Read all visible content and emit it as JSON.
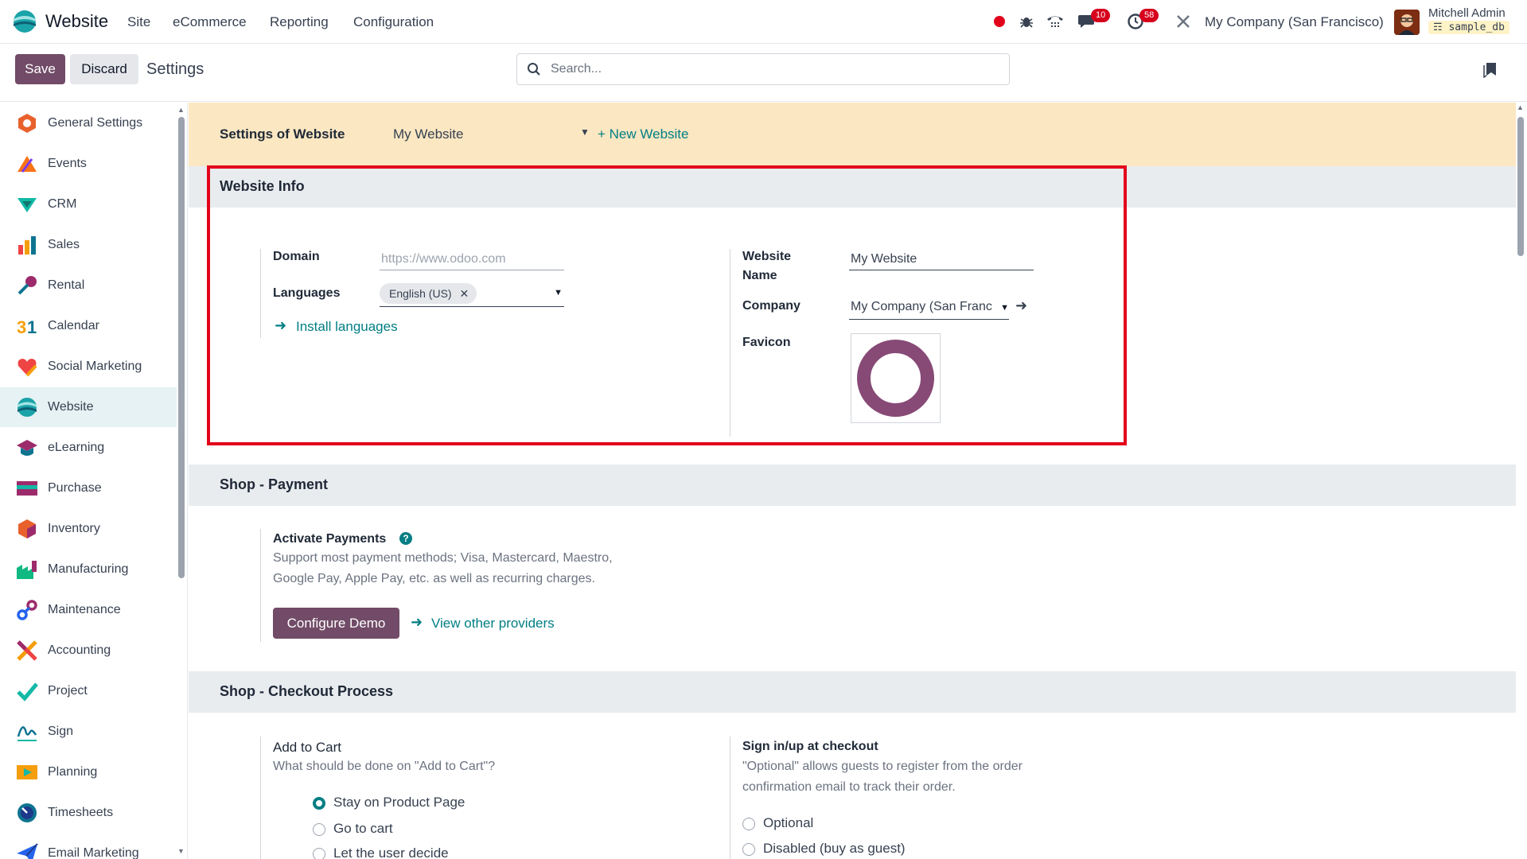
{
  "navbar": {
    "app_name": "Website",
    "menu": [
      "Site",
      "eCommerce",
      "Reporting",
      "Configuration"
    ],
    "chat_badge": "10",
    "activity_badge": "58",
    "company": "My Company (San Francisco)",
    "user_name": "Mitchell Admin",
    "db_name": "sample_db"
  },
  "control": {
    "save_label": "Save",
    "discard_label": "Discard",
    "breadcrumb": "Settings",
    "search_placeholder": "Search..."
  },
  "sidebar": {
    "items": [
      {
        "label": "General Settings",
        "icon": "general-settings-icon",
        "color": "#e8612c"
      },
      {
        "label": "Events",
        "icon": "events-icon",
        "color": "#f97316"
      },
      {
        "label": "CRM",
        "icon": "crm-icon",
        "color": "#10b9a6"
      },
      {
        "label": "Sales",
        "icon": "sales-icon",
        "color": "#f59e0b"
      },
      {
        "label": "Rental",
        "icon": "rental-icon",
        "color": "#0e7490"
      },
      {
        "label": "Calendar",
        "icon": "calendar-icon",
        "color": "#f59e0b"
      },
      {
        "label": "Social Marketing",
        "icon": "social-marketing-icon",
        "color": "#ef4444"
      },
      {
        "label": "Website",
        "icon": "website-icon",
        "color": "#1aa3a8"
      },
      {
        "label": "eLearning",
        "icon": "elearning-icon",
        "color": "#0e7490"
      },
      {
        "label": "Purchase",
        "icon": "purchase-icon",
        "color": "#9d2b6b"
      },
      {
        "label": "Inventory",
        "icon": "inventory-icon",
        "color": "#e8612c"
      },
      {
        "label": "Manufacturing",
        "icon": "manufacturing-icon",
        "color": "#10b981"
      },
      {
        "label": "Maintenance",
        "icon": "maintenance-icon",
        "color": "#2563eb"
      },
      {
        "label": "Accounting",
        "icon": "accounting-icon",
        "color": "#ef4444"
      },
      {
        "label": "Project",
        "icon": "project-icon",
        "color": "#14b8a6"
      },
      {
        "label": "Sign",
        "icon": "sign-icon",
        "color": "#0e7490"
      },
      {
        "label": "Planning",
        "icon": "planning-icon",
        "color": "#f59e0b"
      },
      {
        "label": "Timesheets",
        "icon": "timesheets-icon",
        "color": "#0e7490"
      },
      {
        "label": "Email Marketing",
        "icon": "email-marketing-icon",
        "color": "#2563eb"
      }
    ]
  },
  "settings": {
    "site_bar_label": "Settings of Website",
    "website_select": "My Website",
    "new_website": "+ New Website",
    "website_info": {
      "title": "Website Info",
      "domain_label": "Domain",
      "domain_placeholder": "https://www.odoo.com",
      "languages_label": "Languages",
      "language_tag": "English (US)",
      "install_languages": "Install languages",
      "website_name_label_1": "Website",
      "website_name_label_2": "Name",
      "website_name_value": "My Website",
      "company_label": "Company",
      "company_value": "My Company (San Franc",
      "favicon_label": "Favicon"
    },
    "shop_payment": {
      "title": "Shop - Payment",
      "activate_label": "Activate Payments",
      "desc_1": "Support most payment methods; Visa, Mastercard, Maestro,",
      "desc_2": "Google Pay, Apple Pay, etc. as well as recurring charges.",
      "configure_button": "Configure Demo",
      "view_providers": "View other providers"
    },
    "checkout": {
      "title": "Shop - Checkout Process",
      "add_to_cart_label": "Add to Cart",
      "add_to_cart_desc": "What should be done on \"Add to Cart\"?",
      "cart_options": [
        "Stay on Product Page",
        "Go to cart",
        "Let the user decide"
      ],
      "signin_label": "Sign in/up at checkout",
      "signin_desc_1": "\"Optional\" allows guests to register from the order",
      "signin_desc_2": "confirmation email to track their order.",
      "signin_options": [
        "Optional",
        "Disabled (buy as guest)"
      ]
    }
  }
}
